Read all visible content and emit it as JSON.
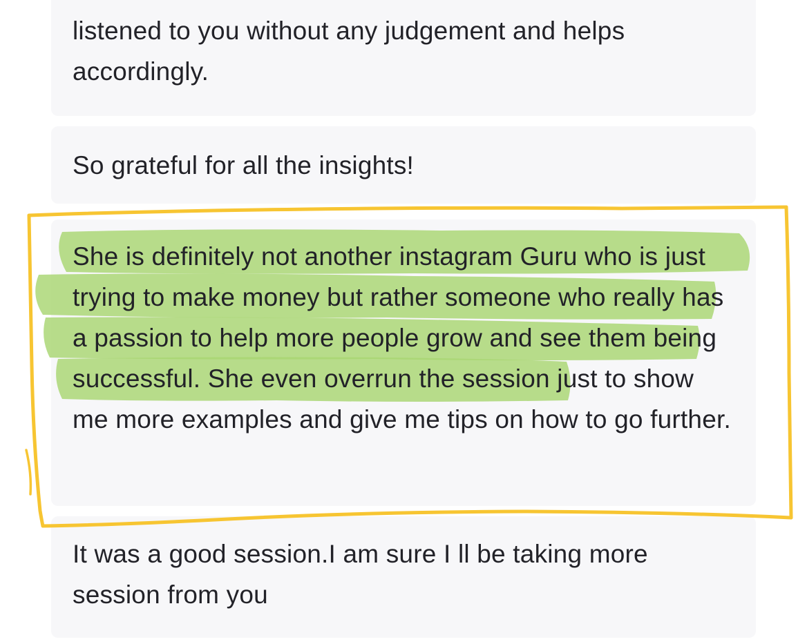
{
  "reviews": [
    {
      "text": "listened to you without any judgement and helps accordingly."
    },
    {
      "text": "So grateful for all the insights!"
    },
    {
      "text_highlighted": "She is definitely not another instagram Guru who is just trying to make money but rather someone who really has a passion to help more people grow and see them being successful.",
      "text_rest": " She even overrun the session just to show me more examples and give me tips on how to go further."
    },
    {
      "text": "It was a good session.I am sure I ll be taking more session from you"
    }
  ],
  "annotations": {
    "highlight_color": "#a8d672",
    "box_color": "#f7c532",
    "card_background": "#f7f7f9"
  }
}
